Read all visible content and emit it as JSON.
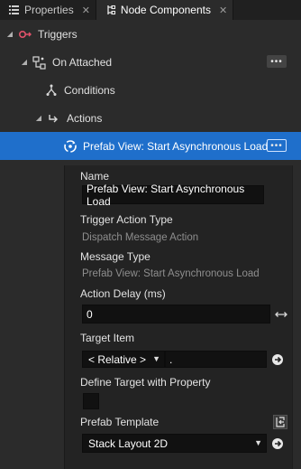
{
  "tabs": [
    {
      "label": "Properties",
      "icon": "properties-list-icon",
      "active": false
    },
    {
      "label": "Node Components",
      "icon": "node-components-icon",
      "active": true
    }
  ],
  "tree": {
    "triggers_label": "Triggers",
    "on_attached_label": "On Attached",
    "conditions_label": "Conditions",
    "actions_label": "Actions",
    "selected_action_label": "Prefab View: Start Asynchronous Load",
    "more_glyph": "•••"
  },
  "details": {
    "name_label": "Name",
    "name_value": "Prefab View: Start Asynchronous Load",
    "trigger_action_type_label": "Trigger Action Type",
    "trigger_action_type_value": "Dispatch Message Action",
    "message_type_label": "Message Type",
    "message_type_value": "Prefab View: Start Asynchronous Load",
    "action_delay_label": "Action Delay (ms)",
    "action_delay_value": "0",
    "target_item_label": "Target Item",
    "target_item_mode": "< Relative >",
    "target_item_path": ".",
    "define_target_label": "Define Target with Property",
    "define_target_checked": false,
    "prefab_template_label": "Prefab Template",
    "prefab_template_value": "Stack Layout 2D"
  },
  "colors": {
    "selection": "#1f6fcb",
    "panel_bg": "#2b2b2b",
    "field_bg": "#111111",
    "trigger_icon": "#e0526a"
  }
}
